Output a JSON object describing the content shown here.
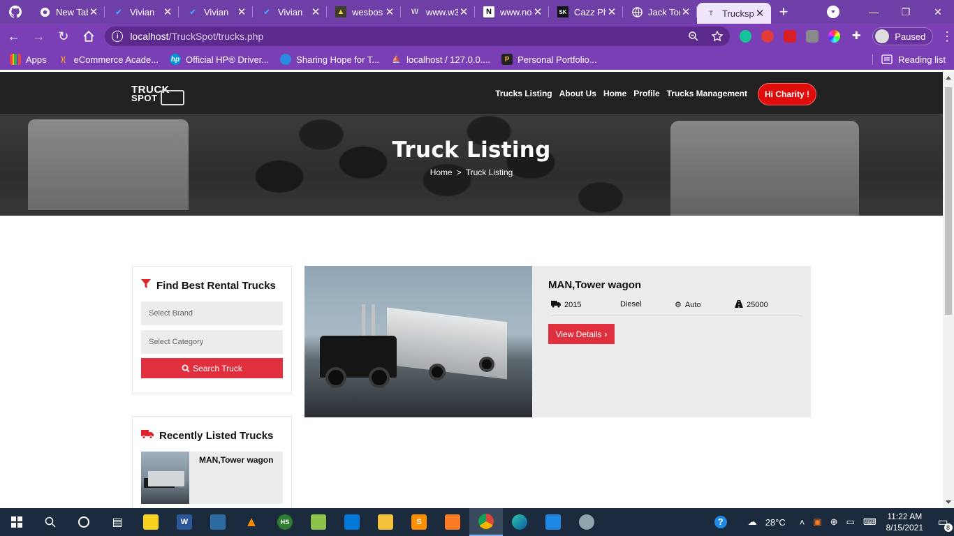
{
  "browser": {
    "tabs": [
      {
        "title": "",
        "icon": "github-icon"
      },
      {
        "title": "New Tab",
        "icon": "chrome-icon"
      },
      {
        "title": "Vivian",
        "icon": "vivian-check-icon"
      },
      {
        "title": "Vivian",
        "icon": "vivian-check-icon"
      },
      {
        "title": "Vivian",
        "icon": "vivian-check-icon"
      },
      {
        "title": "wesbos",
        "icon": "wesbos-icon"
      },
      {
        "title": "www.w3",
        "icon": "w3schools-icon"
      },
      {
        "title": "www.no",
        "icon": "notion-icon"
      },
      {
        "title": "Cazz Ph",
        "icon": "sk-icon"
      },
      {
        "title": "Jack Tor",
        "icon": "globe-icon"
      },
      {
        "title": "Trucksp",
        "icon": "truckspot-icon",
        "active": true
      }
    ],
    "url_host": "localhost",
    "url_path": "/TruckSpot/trucks.php",
    "profile_label": "Paused",
    "bookmarks": [
      {
        "label": "Apps",
        "icon": "apps-grid-icon",
        "color": "#e8453c"
      },
      {
        "label": "eCommerce Acade...",
        "icon": "ecommerce-icon",
        "color": "#f4a11d"
      },
      {
        "label": "Official HP® Driver...",
        "icon": "hp-icon",
        "color": "#0096d6"
      },
      {
        "label": "Sharing Hope for T...",
        "icon": "sharing-hope-icon",
        "color": "#2a8ae2"
      },
      {
        "label": "localhost / 127.0.0....",
        "icon": "phpmyadmin-icon",
        "color": "#f49d2a"
      },
      {
        "label": "Personal Portfolio...",
        "icon": "portfolio-icon",
        "color": "#222222"
      }
    ],
    "reading_list": "Reading list"
  },
  "site": {
    "logo_line1": "TRUCK",
    "logo_line2": "SPOT",
    "nav": [
      "Trucks Listing",
      "About Us",
      "Home",
      "Profile",
      "Trucks Management"
    ],
    "user_button": "Hi Charity !",
    "page_title": "Truck Listing",
    "breadcrumb": {
      "home": "Home",
      "separator": ">",
      "current": "Truck Listing"
    },
    "search_widget": {
      "title": "Find Best Rental Trucks",
      "brand_placeholder": "Select Brand",
      "category_placeholder": "Select Category",
      "button": "Search Truck"
    },
    "recent_widget": {
      "title": "Recently Listed Trucks",
      "items": [
        {
          "name": "MAN,Tower wagon"
        }
      ]
    },
    "listings": [
      {
        "name": "MAN,Tower wagon",
        "year": "2015",
        "fuel": "Diesel",
        "transmission": "Auto",
        "mileage": "25000",
        "button": "View Details"
      }
    ],
    "colors": {
      "accent": "#e0303e",
      "header": "#212121",
      "user_button": "#e00b0b"
    }
  },
  "taskbar": {
    "weather": "28°C",
    "time": "11:22 AM",
    "date": "8/15/2021",
    "notifications": "8"
  }
}
